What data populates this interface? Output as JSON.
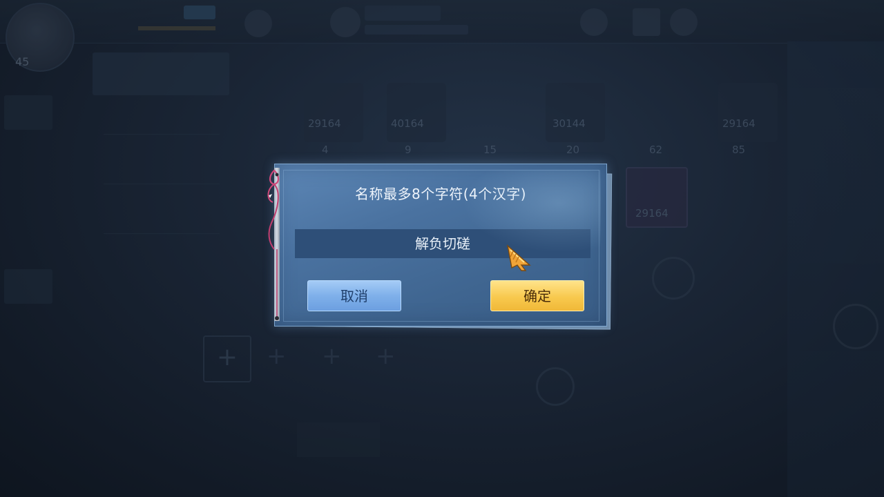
{
  "dialog": {
    "title": "名称最多8个字符(4个汉字)",
    "input_value": "解负切磋",
    "cancel_label": "取消",
    "confirm_label": "确定"
  },
  "background": {
    "level": "45",
    "stat_values": [
      "29164",
      "40164",
      "30144",
      "29164",
      "29164"
    ],
    "row_numbers": [
      "4",
      "9",
      "15",
      "20",
      "62",
      "85"
    ]
  },
  "colors": {
    "dialog_bg": "#4a72a0",
    "input_bg": "#2e4f78",
    "cancel_button": "#7fb0ea",
    "confirm_button": "#f8c94e",
    "ribbon": "#d0487a"
  },
  "icons": {
    "cursor": "golden-arrow-cursor",
    "ribbon": "bow-ribbon"
  }
}
